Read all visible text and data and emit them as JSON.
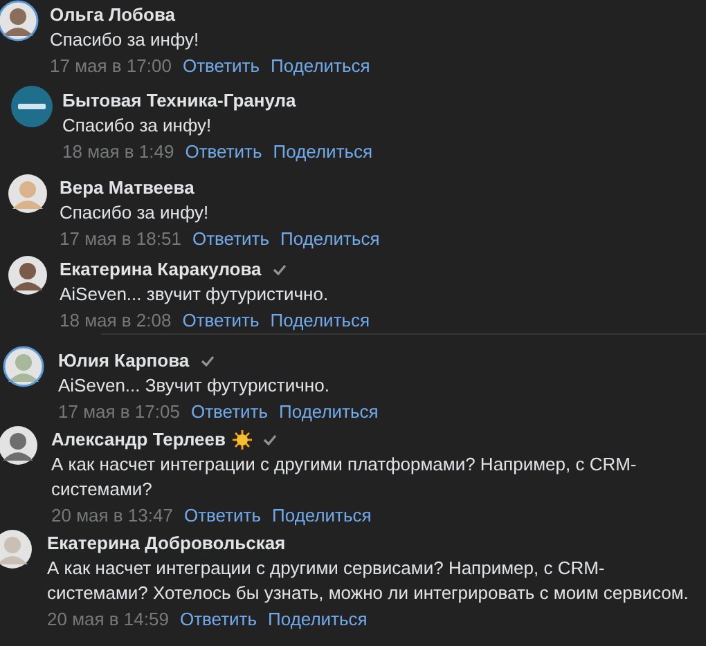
{
  "comments": [
    {
      "author": "Ольга Лобова",
      "kind": "photo",
      "ring": true,
      "verified": false,
      "sun": false,
      "text": "Спасибо за инфу!",
      "date": "17 мая в 17:00",
      "reply": "Ответить",
      "share": "Поделиться"
    },
    {
      "author": "Бытовая Техника-Гранула",
      "kind": "logo",
      "ring": false,
      "verified": false,
      "sun": false,
      "text": "Спасибо за инфу!",
      "date": "18 мая в 1:49",
      "reply": "Ответить",
      "share": "Поделиться"
    },
    {
      "author": "Вера Матвеева",
      "kind": "photo",
      "ring": false,
      "verified": false,
      "sun": false,
      "text": "Спасибо за инфу!",
      "date": "17 мая в 18:51",
      "reply": "Ответить",
      "share": "Поделиться"
    },
    {
      "author": "Екатерина Каракулова",
      "kind": "photo",
      "ring": false,
      "verified": true,
      "sun": false,
      "text": "AiSeven... звучит футуристично.",
      "date": "18 мая в 2:08",
      "reply": "Ответить",
      "share": "Поделиться"
    },
    {
      "author": "Юлия Карпова",
      "kind": "photo",
      "ring": true,
      "verified": true,
      "sun": false,
      "text": "AiSeven... Звучит футуристично.",
      "date": "17 мая в 17:05",
      "reply": "Ответить",
      "share": "Поделиться"
    },
    {
      "author": "Александр Терлеев",
      "kind": "photo",
      "ring": false,
      "verified": true,
      "sun": true,
      "text": "А как насчет интеграции с другими платформами? Например, с CRM-системами?",
      "date": "20 мая в 13:47",
      "reply": "Ответить",
      "share": "Поделиться"
    },
    {
      "author": "Екатерина Добровольская",
      "kind": "photo",
      "ring": false,
      "verified": false,
      "sun": false,
      "text": "А как насчет интеграции с другими сервисами? Например, с CRM-системами? Хотелось бы узнать, можно ли интегрировать с моим сервисом.",
      "date": "20 мая в 14:59",
      "reply": "Ответить",
      "share": "Поделиться"
    }
  ]
}
